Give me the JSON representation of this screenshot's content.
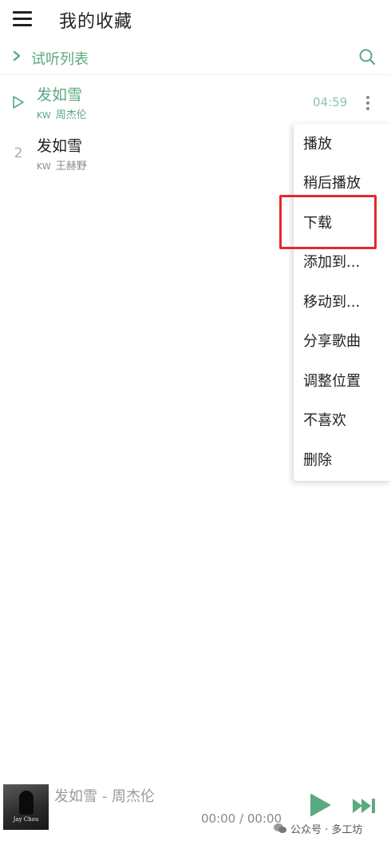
{
  "header": {
    "title": "我的收藏",
    "menu_icon": "hamburger-menu-icon"
  },
  "subheader": {
    "list_name": "试听列表",
    "chevron_icon": "chevron-right-icon",
    "search_icon": "search-icon"
  },
  "songs": [
    {
      "index": "",
      "title": "发如雪",
      "source": "KW",
      "artist": "周杰伦",
      "duration": "04:59",
      "active": true
    },
    {
      "index": "2",
      "title": "发如雪",
      "source": "KW",
      "artist": "王赫野",
      "duration": "",
      "active": false
    }
  ],
  "context_menu": {
    "items": [
      "播放",
      "稍后播放",
      "下载",
      "添加到...",
      "移动到...",
      "分享歌曲",
      "调整位置",
      "不喜欢",
      "删除"
    ],
    "highlighted_item": "下载",
    "highlight_color": "#e12a2a"
  },
  "player": {
    "now_playing": "发如雪 - 周杰伦",
    "time": "00:00 / 00:00",
    "cover_text": "Jay Chou",
    "play_icon": "play-icon",
    "next_icon": "skip-next-icon"
  },
  "watermark": {
    "text": "公众号 · 多工坊",
    "icon": "wechat-icon"
  },
  "colors": {
    "accent": "#5aa980",
    "duration": "#8fc4a5",
    "text": "#222222",
    "muted": "#888888"
  }
}
